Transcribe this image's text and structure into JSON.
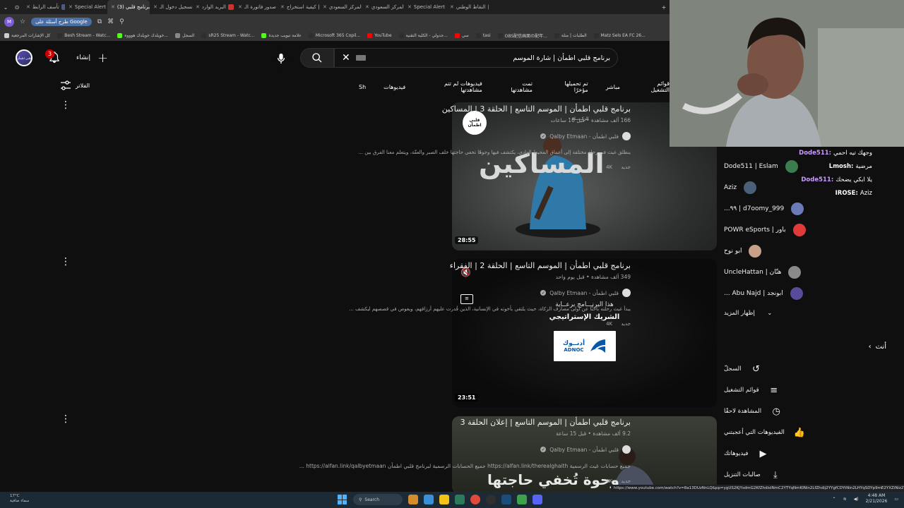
{
  "browser": {
    "tabs": [
      {
        "label": "النقاط الوطني",
        "color": "#2e9b6b"
      },
      {
        "label": "Special Alert",
        "color": "#4b5a8a"
      },
      {
        "label": "المركز السعودي",
        "color": "#3b5998"
      },
      {
        "label": "المركز السعودي",
        "color": "#3b5998"
      },
      {
        "label": "كيفية استخراج",
        "color": "#888888"
      },
      {
        "label": "صدور فاتورة الـ",
        "color": "#cc3333"
      },
      {
        "label": "البريد الوارد",
        "color": "#cc3333"
      },
      {
        "label": "تسجيل دخول الـ",
        "color": "#2a6fbf"
      },
      {
        "label": "(3) برنامج قلبي",
        "color": "#ff0000",
        "active": true
      },
      {
        "label": "Special Alert",
        "color": "#4b5a8a"
      },
      {
        "label": "تأسف الرابط",
        "color": "#4b5a8a"
      }
    ],
    "omnibar": {
      "profile_initial": "M",
      "search_chip": "طرح أسئلة على Google"
    },
    "bookmarks": [
      {
        "label": "كل الإشارات المرجعية",
        "color": "#cccccc"
      },
      {
        "label": "Besh Stream - Watc...",
        "color": "#2e2e2e"
      },
      {
        "label": "خويلدك خويلدك هوووه...",
        "color": "#53fc18"
      },
      {
        "label": "السجل",
        "color": "#888888"
      },
      {
        "label": "sR25 Stream - Watc...",
        "color": "#2e2e2e"
      },
      {
        "label": "علامة تبويب جديدة",
        "color": "#53fc18"
      },
      {
        "label": "Microsoft 365 Copil...",
        "color": "#2e2e2e"
      },
      {
        "label": "YouTube",
        "color": "#ff0000"
      },
      {
        "label": "جدولي - الكلية التقنية...",
        "color": "#2e2e2e"
      },
      {
        "label": "سي",
        "color": "#ff0000"
      },
      {
        "label": "tasi",
        "color": "#2e2e2e"
      },
      {
        "label": "OBS配信画面の配年...",
        "color": "#2e2e2e"
      },
      {
        "label": "الطلبات | منلة",
        "color": "#2e2e2e"
      },
      {
        "label": "Matz Sels EA FC 26...",
        "color": "#2e2e2e"
      }
    ]
  },
  "header": {
    "avatar_label": "قلبي اطمأن",
    "notification_count": "3",
    "create_label": "إنشاء",
    "search_query": "برنامج قلبي اطمأن | شارة الموسم"
  },
  "filters": {
    "filter_label": "الفلاتر",
    "chips": [
      "Sh",
      "فيديوهات",
      "فيديوهات لم تتم مشاهدتها",
      "تمت مشاهدتها",
      "تم تحميلها مؤخرًا",
      "مباشر",
      "قوائم التشغيل"
    ]
  },
  "results": [
    {
      "title": "برنامج قلبي اطمأن | الموسم التاسع | الحلقة 3 | المساكين",
      "meta": "166 ألف مشاهدة • قبل 10 ساعات",
      "channel": "قلبي اطمأن - Qalby Etmaan",
      "description": "ينطلق غيث في رحلة مختلفة إلى أعماق المحيط الهادي، يكتشف فيها وجوهًا تخفي حاجتها خلف الصبر والعفّة، ويتعلم معنا الفرق بين ...",
      "badges": [
        "جديد",
        "4K"
      ],
      "duration": "28:55",
      "thumb_text": "المساكين",
      "thumb_logo": "قلبي اطمأن",
      "thumb_caption": "الزكـــــاة"
    },
    {
      "title": "برنامج قلبي اطمأن | الموسم التاسع | الحلقة 2 | الفقراء",
      "meta": "349 ألف مشاهدة • قبل يوم واحد",
      "channel": "قلبي اطمأن - Qalby Etmaan",
      "description": "يبدأ غيث رحلته باحثًا عن أولى مصارف الزكاة، حيث يلتقي بأخوته في الإنسانية، الذين قُدرت عليهم أرزاقهم، ويغوص في قصصهم ليكشف ...",
      "badges": [
        "جديد",
        "4K"
      ],
      "duration": "23:51",
      "sponsor_line1": "هذا البرنـــامج برعــاية",
      "sponsor_line2": "الشريك الإستراتيجي",
      "sponsor_logo_ar": "أدنــوك",
      "sponsor_logo_en": "ADNOC"
    },
    {
      "title": "برنامج قلبي اطمأن | الموسم التاسع | إعلان الحلقة 3",
      "meta": "9.2 ألف مشاهدة • قبل 15 ساعة",
      "channel": "قلبي اطمأن - Qalby Etmaan",
      "description": "جميع حسابات غيث الرسمية https://alfan.link/therealghaith جميع الحسابات الرسمية لبرنامج قلبي اطمأن https://alfan.link/qalbyetmaan ...",
      "badges": [
        "جديد",
        "4K"
      ],
      "thumb_text": "وحوة تُخفي حاجتها"
    }
  ],
  "chat_overlay": [
    {
      "user": "Dode511:",
      "text": "وجهك تيه احمي",
      "color": "#c79cff"
    },
    {
      "user": "Lmosh:",
      "text": "مرضية",
      "color": "#ffffff"
    },
    {
      "user": "Dode511:",
      "text": "يلا ابكي يضحك",
      "color": "#c79cff"
    },
    {
      "user": "IROSE:",
      "text": "Aziz",
      "color": "#ffffff"
    }
  ],
  "subscriptions": [
    {
      "name": "Dode511 | Eslam",
      "color": "#3b7d4f"
    },
    {
      "name": "Aziz",
      "color": "#4a6078"
    },
    {
      "name": "d7oomy_999 | ٩٩...",
      "color": "#6b7ab8"
    },
    {
      "name": "باور | POWR eSports",
      "color": "#e03b3b"
    },
    {
      "name": "ابو نوح",
      "color": "#c8a08a"
    },
    {
      "name": "هتّان | UncleHattan",
      "color": "#8a8a8a"
    },
    {
      "name": "ابونجد | Abu Najd ...",
      "color": "#5a4a9a"
    }
  ],
  "show_more_label": "إظهار المزيد",
  "you_section": {
    "heading": "أنت",
    "items": [
      {
        "label": "السجلّ",
        "icon": "history-icon"
      },
      {
        "label": "قوائم التشغيل",
        "icon": "playlists-icon"
      },
      {
        "label": "المشاهدة لاحقًا",
        "icon": "watch-later-icon"
      },
      {
        "label": "الفيديوهات التي أعجبتني",
        "icon": "liked-icon"
      },
      {
        "label": "فيديوهاتك",
        "icon": "your-videos-icon"
      },
      {
        "label": "صالبات التنزيل",
        "icon": "downloads-icon"
      }
    ]
  },
  "status_url": "https://www.youtube.com/watch?v=8a13DUzNnLQ&pp=ygUS2KjYsdmG2KfZhdisINmC2YTYqNmKINin2LfZhdij2YYgfCDYtNin2LHYqSDYp9mE2YXZiNiz2YUg",
  "taskbar": {
    "weather_temp": "17°C",
    "weather_desc": "سماء صافية",
    "search_label": "Search",
    "time": "4:48 AM",
    "date": "2/21/2026"
  }
}
